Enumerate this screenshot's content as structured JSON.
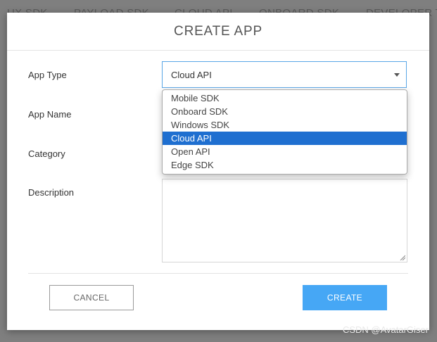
{
  "background": {
    "nav_tabs": [
      "UX SDK",
      "PAYLOAD SDK",
      "CLOUD API",
      "ONBOARD SDK",
      "DEVELOPER T"
    ],
    "watermark": "CSDN @AvatarGiser"
  },
  "modal": {
    "title": "CREATE APP",
    "fields": {
      "app_type_label": "App Type",
      "app_name_label": "App Name",
      "category_label": "Category",
      "description_label": "Description",
      "app_type_value": "Cloud API"
    },
    "dropdown": {
      "options": [
        "Mobile SDK",
        "Onboard SDK",
        "Windows SDK",
        "Cloud API",
        "Open API",
        "Edge SDK"
      ],
      "selected_index": 3
    },
    "buttons": {
      "cancel": "CANCEL",
      "create": "CREATE"
    }
  },
  "colors": {
    "accent": "#46a7f5",
    "selected_option": "#1f6fd0",
    "focus_border": "#5aa6e6"
  }
}
